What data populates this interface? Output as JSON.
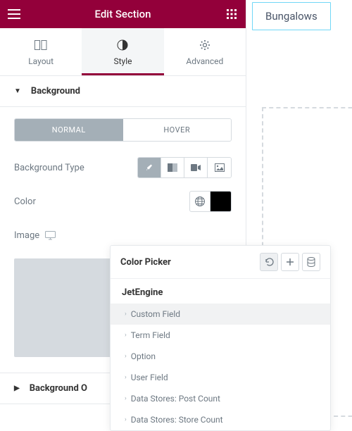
{
  "header": {
    "title": "Edit Section"
  },
  "tabs": [
    {
      "label": "Layout"
    },
    {
      "label": "Style"
    },
    {
      "label": "Advanced"
    }
  ],
  "sections": {
    "background": "Background",
    "background_overlay": "Background O"
  },
  "toggle": {
    "normal": "NORMAL",
    "hover": "HOVER"
  },
  "controls": {
    "bg_type_label": "Background Type",
    "color_label": "Color",
    "image_label": "Image",
    "color_value": "#000000"
  },
  "canvas": {
    "tab_label": "Bungalows"
  },
  "popover": {
    "title": "Color Picker",
    "group": "JetEngine",
    "items": [
      "Custom Field",
      "Term Field",
      "Option",
      "User Field",
      "Data Stores: Post Count",
      "Data Stores: Store Count"
    ]
  }
}
